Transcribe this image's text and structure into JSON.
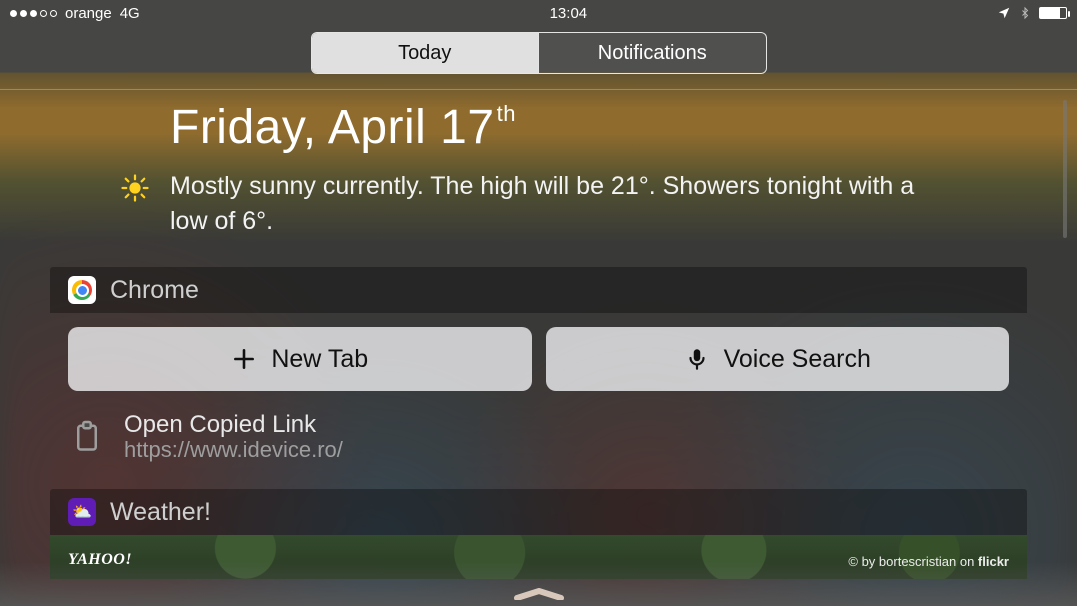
{
  "status": {
    "carrier": "orange",
    "network": "4G",
    "time": "13:04",
    "signal_filled": 3,
    "signal_total": 5,
    "battery_pct": 75
  },
  "tabs": {
    "today": "Today",
    "notifications": "Notifications"
  },
  "today": {
    "date_main": "Friday, April 17",
    "date_suffix": "th",
    "weather_text": "Mostly sunny currently. The high will be 21°. Showers tonight with a low of 6°."
  },
  "chrome": {
    "title": "Chrome",
    "new_tab": "New Tab",
    "voice_search": "Voice Search",
    "open_copied": "Open Copied Link",
    "copied_url": "https://www.idevice.ro/"
  },
  "weather_widget": {
    "title": "Weather!",
    "brand": "YAHOO!",
    "credit_prefix": "© by ",
    "credit_author": "bortescristian",
    "credit_on": " on ",
    "credit_site": "flickr"
  }
}
